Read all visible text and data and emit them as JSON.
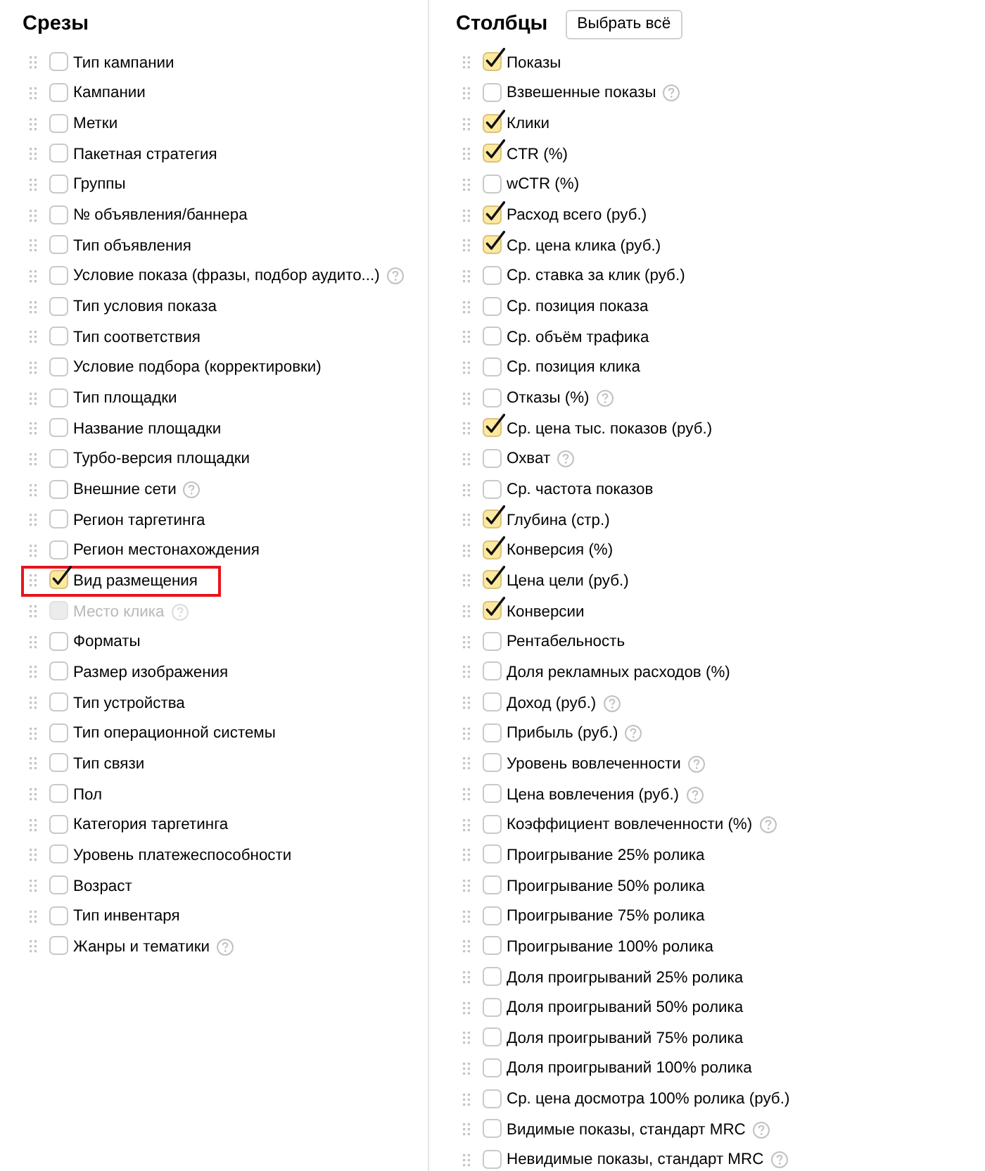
{
  "slices": {
    "title": "Срезы",
    "items": [
      {
        "label": "Тип кампании",
        "checked": false,
        "disabled": false,
        "help": false,
        "highlighted": false
      },
      {
        "label": "Кампании",
        "checked": false,
        "disabled": false,
        "help": false,
        "highlighted": false
      },
      {
        "label": "Метки",
        "checked": false,
        "disabled": false,
        "help": false,
        "highlighted": false
      },
      {
        "label": "Пакетная стратегия",
        "checked": false,
        "disabled": false,
        "help": false,
        "highlighted": false
      },
      {
        "label": "Группы",
        "checked": false,
        "disabled": false,
        "help": false,
        "highlighted": false
      },
      {
        "label": "№ объявления/баннера",
        "checked": false,
        "disabled": false,
        "help": false,
        "highlighted": false
      },
      {
        "label": "Тип объявления",
        "checked": false,
        "disabled": false,
        "help": false,
        "highlighted": false
      },
      {
        "label": "Условие показа (фразы, подбор аудито...)",
        "checked": false,
        "disabled": false,
        "help": true,
        "highlighted": false
      },
      {
        "label": "Тип условия показа",
        "checked": false,
        "disabled": false,
        "help": false,
        "highlighted": false
      },
      {
        "label": "Тип соответствия",
        "checked": false,
        "disabled": false,
        "help": false,
        "highlighted": false
      },
      {
        "label": "Условие подбора (корректировки)",
        "checked": false,
        "disabled": false,
        "help": false,
        "highlighted": false
      },
      {
        "label": "Тип площадки",
        "checked": false,
        "disabled": false,
        "help": false,
        "highlighted": false
      },
      {
        "label": "Название площадки",
        "checked": false,
        "disabled": false,
        "help": false,
        "highlighted": false
      },
      {
        "label": "Турбо-версия площадки",
        "checked": false,
        "disabled": false,
        "help": false,
        "highlighted": false
      },
      {
        "label": "Внешние сети",
        "checked": false,
        "disabled": false,
        "help": true,
        "highlighted": false
      },
      {
        "label": "Регион таргетинга",
        "checked": false,
        "disabled": false,
        "help": false,
        "highlighted": false
      },
      {
        "label": "Регион местонахождения",
        "checked": false,
        "disabled": false,
        "help": false,
        "highlighted": false
      },
      {
        "label": "Вид размещения",
        "checked": true,
        "disabled": false,
        "help": false,
        "highlighted": true
      },
      {
        "label": "Место клика",
        "checked": false,
        "disabled": true,
        "help": true,
        "highlighted": false
      },
      {
        "label": "Форматы",
        "checked": false,
        "disabled": false,
        "help": false,
        "highlighted": false
      },
      {
        "label": "Размер изображения",
        "checked": false,
        "disabled": false,
        "help": false,
        "highlighted": false
      },
      {
        "label": "Тип устройства",
        "checked": false,
        "disabled": false,
        "help": false,
        "highlighted": false
      },
      {
        "label": "Тип операционной системы",
        "checked": false,
        "disabled": false,
        "help": false,
        "highlighted": false
      },
      {
        "label": "Тип связи",
        "checked": false,
        "disabled": false,
        "help": false,
        "highlighted": false
      },
      {
        "label": "Пол",
        "checked": false,
        "disabled": false,
        "help": false,
        "highlighted": false
      },
      {
        "label": "Категория таргетинга",
        "checked": false,
        "disabled": false,
        "help": false,
        "highlighted": false
      },
      {
        "label": "Уровень платежеспособности",
        "checked": false,
        "disabled": false,
        "help": false,
        "highlighted": false
      },
      {
        "label": "Возраст",
        "checked": false,
        "disabled": false,
        "help": false,
        "highlighted": false
      },
      {
        "label": "Тип инвентаря",
        "checked": false,
        "disabled": false,
        "help": false,
        "highlighted": false
      },
      {
        "label": "Жанры и тематики",
        "checked": false,
        "disabled": false,
        "help": true,
        "highlighted": false
      }
    ]
  },
  "columns": {
    "title": "Столбцы",
    "select_all_button": "Выбрать всё",
    "items": [
      {
        "label": "Показы",
        "checked": true,
        "help": false
      },
      {
        "label": "Взвешенные показы",
        "checked": false,
        "help": true
      },
      {
        "label": "Клики",
        "checked": true,
        "help": false
      },
      {
        "label": "CTR (%)",
        "checked": true,
        "help": false
      },
      {
        "label": "wCTR (%)",
        "checked": false,
        "help": false
      },
      {
        "label": "Расход всего (руб.)",
        "checked": true,
        "help": false
      },
      {
        "label": "Ср. цена клика (руб.)",
        "checked": true,
        "help": false
      },
      {
        "label": "Ср. ставка за клик (руб.)",
        "checked": false,
        "help": false
      },
      {
        "label": "Ср. позиция показа",
        "checked": false,
        "help": false
      },
      {
        "label": "Ср. объём трафика",
        "checked": false,
        "help": false
      },
      {
        "label": "Ср. позиция клика",
        "checked": false,
        "help": false
      },
      {
        "label": "Отказы (%)",
        "checked": false,
        "help": true
      },
      {
        "label": "Ср. цена тыс. показов (руб.)",
        "checked": true,
        "help": false
      },
      {
        "label": "Охват",
        "checked": false,
        "help": true
      },
      {
        "label": "Ср. частота показов",
        "checked": false,
        "help": false
      },
      {
        "label": "Глубина (стр.)",
        "checked": true,
        "help": false
      },
      {
        "label": "Конверсия (%)",
        "checked": true,
        "help": false
      },
      {
        "label": "Цена цели (руб.)",
        "checked": true,
        "help": false
      },
      {
        "label": "Конверсии",
        "checked": true,
        "help": false
      },
      {
        "label": "Рентабельность",
        "checked": false,
        "help": false
      },
      {
        "label": "Доля рекламных расходов (%)",
        "checked": false,
        "help": false
      },
      {
        "label": "Доход (руб.)",
        "checked": false,
        "help": true
      },
      {
        "label": "Прибыль (руб.)",
        "checked": false,
        "help": true
      },
      {
        "label": "Уровень вовлеченности",
        "checked": false,
        "help": true
      },
      {
        "label": "Цена вовлечения (руб.)",
        "checked": false,
        "help": true
      },
      {
        "label": "Коэффициент вовлеченности (%)",
        "checked": false,
        "help": true
      },
      {
        "label": "Проигрывание 25% ролика",
        "checked": false,
        "help": false
      },
      {
        "label": "Проигрывание 50% ролика",
        "checked": false,
        "help": false
      },
      {
        "label": "Проигрывание 75% ролика",
        "checked": false,
        "help": false
      },
      {
        "label": "Проигрывание 100% ролика",
        "checked": false,
        "help": false
      },
      {
        "label": "Доля проигрываний 25% ролика",
        "checked": false,
        "help": false
      },
      {
        "label": "Доля проигрываний 50% ролика",
        "checked": false,
        "help": false
      },
      {
        "label": "Доля проигрываний 75% ролика",
        "checked": false,
        "help": false
      },
      {
        "label": "Доля проигрываний 100% ролика",
        "checked": false,
        "help": false
      },
      {
        "label": "Ср. цена досмотра 100% ролика (руб.)",
        "checked": false,
        "help": false
      },
      {
        "label": "Видимые показы, стандарт MRC",
        "checked": false,
        "help": true
      },
      {
        "label": "Невидимые показы, стандарт MRC",
        "checked": false,
        "help": true
      }
    ]
  }
}
